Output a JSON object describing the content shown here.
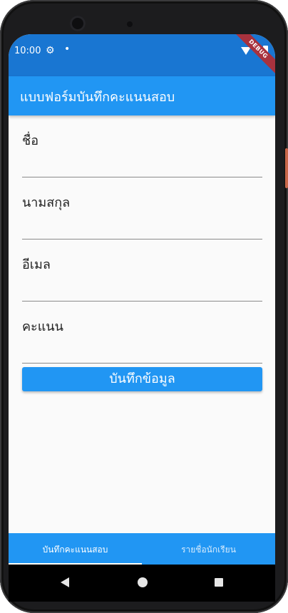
{
  "status_bar": {
    "time": "10:00",
    "gear_icon": "⚙",
    "dot": "•"
  },
  "debug_banner": "DEBUG",
  "app_bar": {
    "title": "แบบฟอร์มบันทึกคะแนนสอบ"
  },
  "form": {
    "fields": [
      {
        "label": "ชื่อ",
        "value": ""
      },
      {
        "label": "นามสกุล",
        "value": ""
      },
      {
        "label": "อีเมล",
        "value": ""
      },
      {
        "label": "คะแนน",
        "value": ""
      }
    ],
    "save_label": "บันทึกข้อมูล"
  },
  "tabs": [
    {
      "label": "บันทึกคะแนนสอบ",
      "active": true
    },
    {
      "label": "รายชื่อนักเรียน",
      "active": false
    }
  ],
  "colors": {
    "status_bar": "#1976d2",
    "app_bar": "#2196f3",
    "button": "#2196f3",
    "debug_ribbon": "#a8323e"
  }
}
